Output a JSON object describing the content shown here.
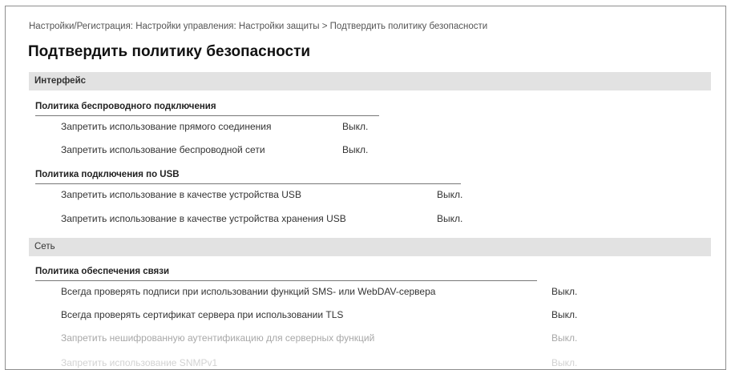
{
  "breadcrumb": "Настройки/Регистрация: Настройки управления: Настройки защиты > Подтвердить политику безопасности",
  "page_title": "Подтвердить политику безопасности",
  "sections": {
    "interface": {
      "title": "Интерфейс",
      "wireless": {
        "heading": "Политика беспроводного подключения",
        "rows": [
          {
            "label": "Запретить использование прямого соединения",
            "value": "Выкл."
          },
          {
            "label": "Запретить использование беспроводной сети",
            "value": "Выкл."
          }
        ]
      },
      "usb": {
        "heading": "Политика подключения по USB",
        "rows": [
          {
            "label": "Запретить использование в качестве устройства USB",
            "value": "Выкл."
          },
          {
            "label": "Запретить использование в качестве устройства хранения USB",
            "value": "Выкл."
          }
        ]
      }
    },
    "network": {
      "title": "Сеть",
      "communication": {
        "heading": "Политика обеспечения связи",
        "rows": [
          {
            "label": "Всегда проверять подписи при использовании функций SMS- или WebDAV-сервера",
            "value": "Выкл."
          },
          {
            "label": "Всегда проверять сертификат сервера при использовании TLS",
            "value": "Выкл."
          },
          {
            "label": "Запретить нешифрованную аутентификацию для серверных функций",
            "value": "Выкл."
          },
          {
            "label": "Запретить использование SNMPv1",
            "value": "Выкл."
          }
        ]
      }
    }
  }
}
